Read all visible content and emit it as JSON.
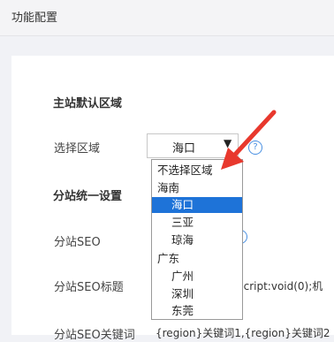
{
  "header": {
    "title": "功能配置"
  },
  "main_section": {
    "title": "主站默认区域"
  },
  "region_field": {
    "label": "选择区域",
    "selected": "海口",
    "dropdown_arrow": "chevron-down-icon",
    "help": "?"
  },
  "dropdown": {
    "items": [
      {
        "label": "不选择区域"
      },
      {
        "label": "海南"
      },
      {
        "label": "海口"
      },
      {
        "label": "三亚"
      },
      {
        "label": "琼海"
      },
      {
        "label": "广东"
      },
      {
        "label": "广州"
      },
      {
        "label": "深圳"
      },
      {
        "label": "东莞"
      }
    ]
  },
  "sub_section": {
    "title": "分站统一设置"
  },
  "seo": {
    "label": "分站SEO",
    "help": "?",
    "title_label": "分站SEO标题",
    "title_value": "ascript:void(0);机",
    "keywords_label": "分站SEO关键词",
    "keywords_value": "{region}关键词1,{region}关键词2"
  },
  "colors": {
    "accent": "#1e73d8",
    "arrow": "#e8382d",
    "help": "#4a90e2"
  }
}
